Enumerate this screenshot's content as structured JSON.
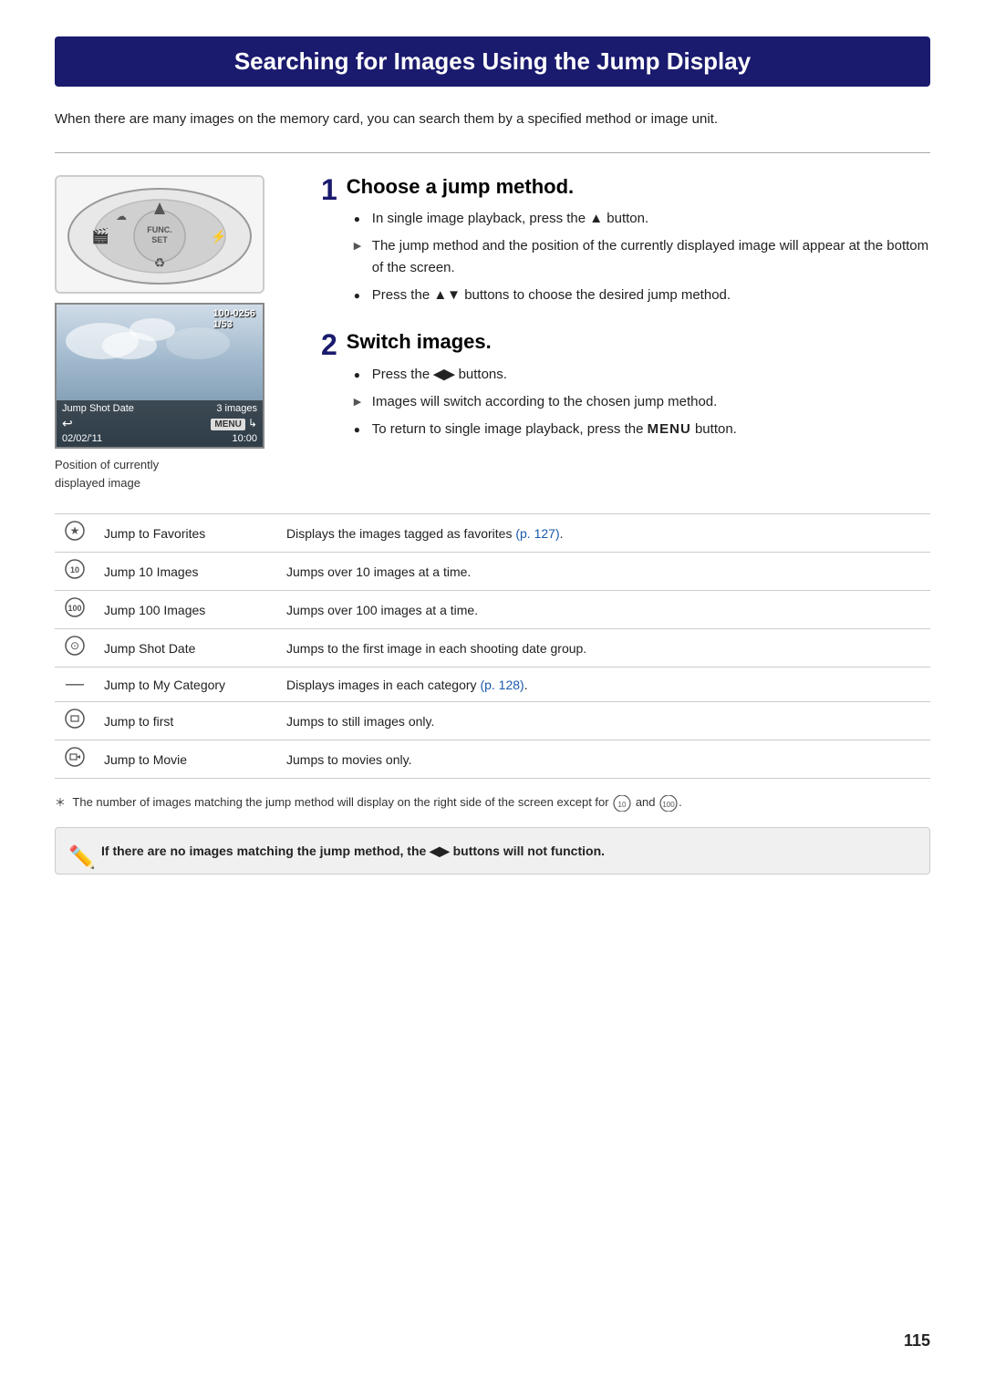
{
  "page": {
    "title": "Searching for Images Using the Jump Display",
    "intro": "When there are many images on the memory card, you can search them by a specified method or image unit.",
    "page_number": "115"
  },
  "step1": {
    "number": "1",
    "title": "Choose a jump method.",
    "bullets": [
      {
        "type": "circle",
        "text": "In single image playback, press the ▲ button."
      },
      {
        "type": "triangle",
        "text": "The jump method and the position of the currently displayed image will appear at the bottom of the screen."
      },
      {
        "type": "circle",
        "text": "Press the ▲▼ buttons to choose the desired jump method."
      }
    ]
  },
  "step2": {
    "number": "2",
    "title": "Switch images.",
    "bullets": [
      {
        "type": "circle",
        "text": "Press the ◀▶ buttons."
      },
      {
        "type": "triangle",
        "text": "Images will switch according to the chosen jump method."
      },
      {
        "type": "circle",
        "text": "To return to single image playback, press the MENU button."
      }
    ]
  },
  "camera_screen": {
    "top_right": "100-0256",
    "fraction": "1/53",
    "bottom_left": "Jump Shot Date",
    "bottom_right1": "3 images",
    "bottom_right2": "MENU",
    "bottom_date": "02/02/'11",
    "bottom_time": "10:00"
  },
  "caption": {
    "line1": "Position of currently",
    "line2": "displayed image"
  },
  "table": {
    "rows": [
      {
        "icon": "★",
        "name": "Jump to Favorites",
        "desc": "Displays the images tagged as favorites (p. 127).",
        "link": "p. 127"
      },
      {
        "icon": "⑩",
        "name": "Jump 10 Images",
        "desc": "Jumps over 10 images at a time.",
        "link": ""
      },
      {
        "icon": "⑩⓪",
        "name": "Jump 100 Images",
        "desc": "Jumps over 100 images at a time.",
        "link": ""
      },
      {
        "icon": "⊙",
        "name": "Jump Shot Date",
        "desc": "Jumps to the first image in each shooting date group.",
        "link": ""
      },
      {
        "icon": "—",
        "name": "Jump to My Category",
        "desc": "Displays images in each category (p. 128).",
        "link": "p. 128"
      },
      {
        "icon": "⊡",
        "name": "Jump to first",
        "desc": "Jumps to still images only.",
        "link": ""
      },
      {
        "icon": "⊞",
        "name": "Jump to Movie",
        "desc": "Jumps to movies only.",
        "link": ""
      }
    ]
  },
  "footnote": "The number of images matching the jump method will display on the right side of the screen except for  and .",
  "note": {
    "text": "If there are no images matching the jump method, the ◀▶ buttons will not function."
  }
}
